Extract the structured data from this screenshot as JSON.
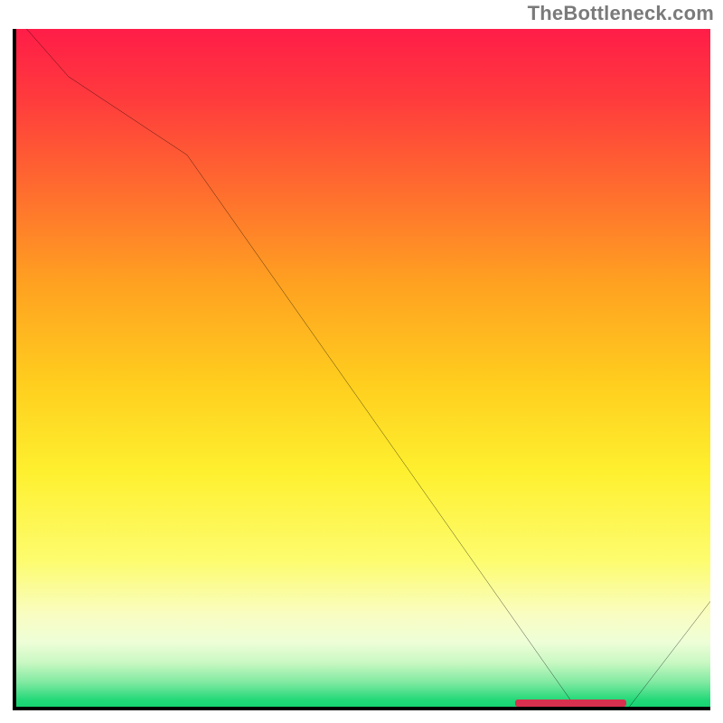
{
  "attribution": "TheBottleneck.com",
  "colors": {
    "axis": "#000000",
    "curve": "#000000",
    "marker": "#d9304f",
    "attribution_text": "#7a7a7a"
  },
  "chart_data": {
    "type": "line",
    "title": "",
    "xlabel": "",
    "ylabel": "",
    "xlim": [
      0,
      100
    ],
    "ylim": [
      0,
      100
    ],
    "x": [
      2,
      8,
      25,
      81,
      88,
      100
    ],
    "values": [
      100,
      93,
      81.5,
      0,
      0,
      16
    ],
    "annotations": [
      {
        "kind": "optimal_band",
        "x_start": 72,
        "x_end": 88,
        "y": 0.6
      }
    ],
    "note": "Values estimated from plot; interior points of the long descending segment and the baseline follow the straight lines between listed vertices."
  }
}
